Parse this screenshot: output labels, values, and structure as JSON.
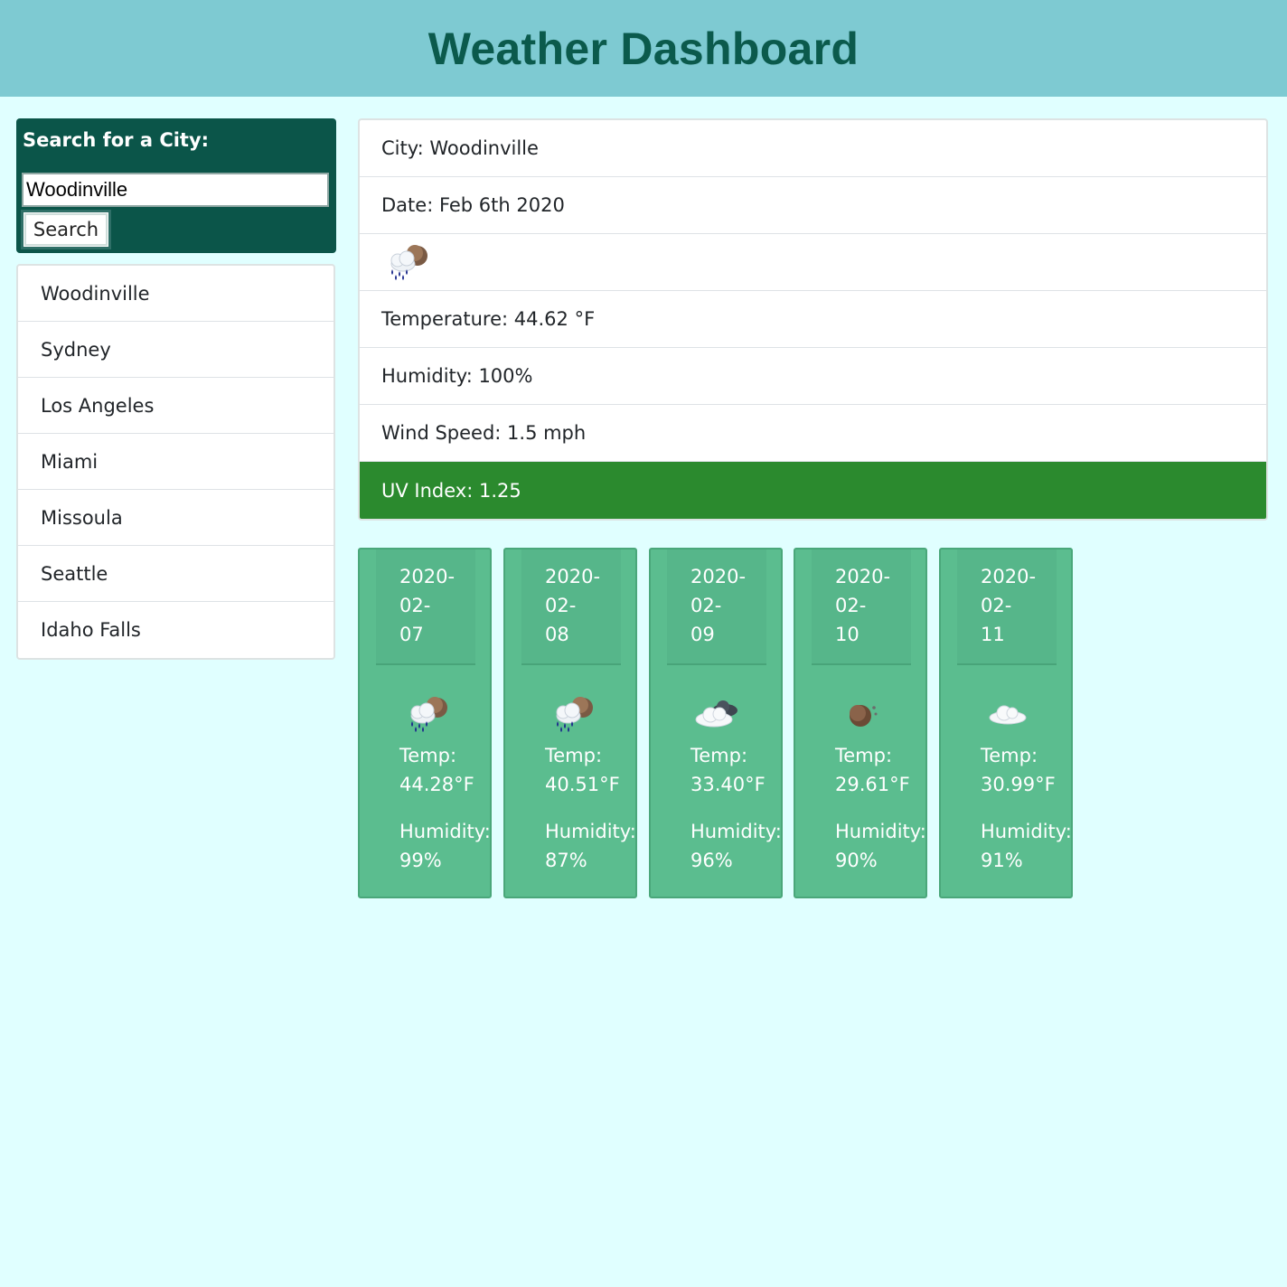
{
  "header": {
    "title": "Weather Dashboard"
  },
  "search": {
    "title": "Search for a City:",
    "value": "Woodinville",
    "button_label": "Search"
  },
  "history": [
    "Woodinville",
    "Sydney",
    "Los Angeles",
    "Miami",
    "Missoula",
    "Seattle",
    "Idaho Falls"
  ],
  "current": {
    "city": "City: Woodinville",
    "date": "Date: Feb 6th 2020",
    "icon": "rain-and-night-icon",
    "temperature": "Temperature: 44.62 °F",
    "humidity": "Humidity: 100%",
    "wind": "Wind Speed: 1.5 mph",
    "uv": "UV Index: 1.25"
  },
  "forecast": [
    {
      "date_parts": [
        "2020-",
        "02-",
        "07"
      ],
      "icon": "rain-and-night-icon",
      "temp_label": "Temp:",
      "temp": "44.28°F",
      "hum_label": "Humidity:",
      "humidity": "99%"
    },
    {
      "date_parts": [
        "2020-",
        "02-",
        "08"
      ],
      "icon": "rain-and-night-icon",
      "temp_label": "Temp:",
      "temp": "40.51°F",
      "hum_label": "Humidity:",
      "humidity": "87%"
    },
    {
      "date_parts": [
        "2020-",
        "02-",
        "09"
      ],
      "icon": "broken-clouds-icon",
      "temp_label": "Temp:",
      "temp": "33.40°F",
      "hum_label": "Humidity:",
      "humidity": "96%"
    },
    {
      "date_parts": [
        "2020-",
        "02-",
        "10"
      ],
      "icon": "night-clear-icon",
      "temp_label": "Temp:",
      "temp": "29.61°F",
      "hum_label": "Humidity:",
      "humidity": "90%"
    },
    {
      "date_parts": [
        "2020-",
        "02-",
        "11"
      ],
      "icon": "cloud-icon",
      "temp_label": "Temp:",
      "temp": "30.99°F",
      "hum_label": "Humidity:",
      "humidity": "91%"
    }
  ],
  "colors": {
    "header_bg": "#7ecad2",
    "title": "#0b5a4c",
    "search_bg": "#0b5549",
    "uv_bg": "#2b8a2e",
    "forecast_bg": "#5bbd8f"
  }
}
